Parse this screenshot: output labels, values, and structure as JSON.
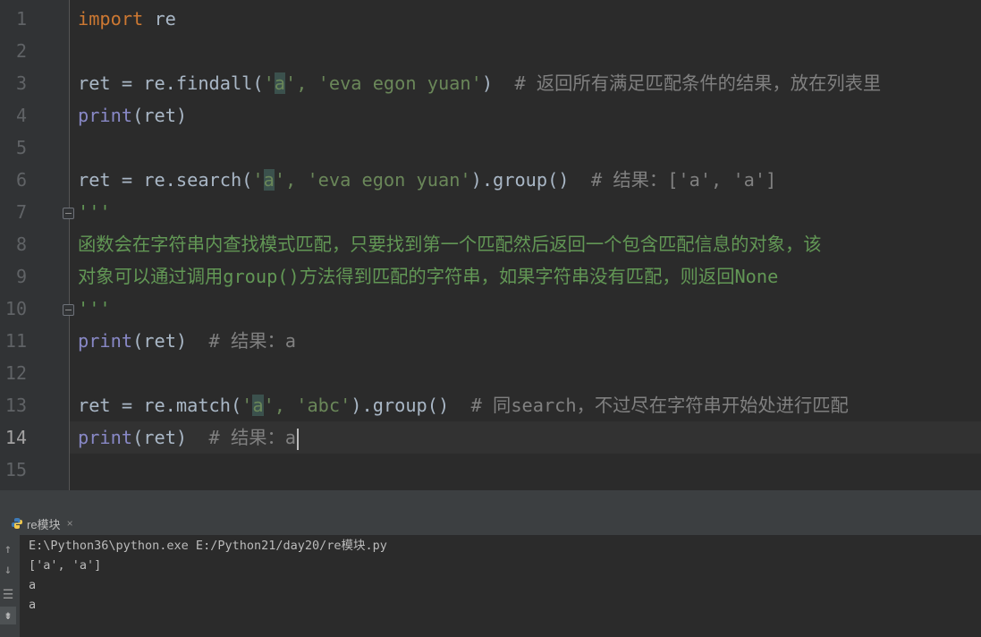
{
  "editor": {
    "line_numbers": [
      "1",
      "2",
      "3",
      "4",
      "5",
      "6",
      "7",
      "8",
      "9",
      "10",
      "11",
      "12",
      "13",
      "14",
      "15"
    ],
    "current_line": "14",
    "lines": {
      "l1": {
        "kw": "import",
        "rest": " re"
      },
      "l3": {
        "code_a": "ret = re.findall(",
        "q1": "'",
        "m": "a",
        "q2": "', ",
        "s2": "'eva egon yuan'",
        "code_b": ")  ",
        "comment": "# 返回所有满足匹配条件的结果，放在列表里"
      },
      "l4": {
        "fn": "print",
        "rest": "(ret)"
      },
      "l6": {
        "code_a": "ret = re.search(",
        "q1": "'",
        "m": "a",
        "q2": "', ",
        "s2": "'eva egon yuan'",
        "code_b": ").group()  ",
        "comment": "# 结果：['a', 'a']"
      },
      "l7": {
        "doc": "'''"
      },
      "l8": {
        "doc": "函数会在字符串内查找模式匹配，只要找到第一个匹配然后返回一个包含匹配信息的对象，该"
      },
      "l9": {
        "doc": "对象可以通过调用group()方法得到匹配的字符串，如果字符串没有匹配，则返回None"
      },
      "l10": {
        "doc": "'''"
      },
      "l11": {
        "fn": "print",
        "rest": "(ret)  ",
        "comment": "# 结果：a"
      },
      "l13": {
        "code_a": "ret = re.match(",
        "q1": "'",
        "m": "a",
        "q2": "', ",
        "s2": "'abc'",
        "code_b": ").group()  ",
        "comment": "# 同search，不过尽在字符串开始处进行匹配"
      },
      "l14": {
        "fn": "print",
        "rest": "(ret)  ",
        "comment": "# 结果：a"
      }
    }
  },
  "run_panel": {
    "tab_label": "re模块",
    "tab_close": "×",
    "output": [
      "E:\\Python36\\python.exe E:/Python21/day20/re模块.py",
      "['a', 'a']",
      "a",
      "a"
    ]
  },
  "colors": {
    "editor_bg": "#2b2b2b",
    "keyword": "#cc7832",
    "builtin": "#8888c6",
    "string": "#6a8759",
    "comment": "#808080",
    "docstring": "#629755"
  },
  "icons": [
    "python-file-icon",
    "close-icon",
    "arrow-up-icon",
    "arrow-down-icon",
    "soft-wrap-icon",
    "scroll-to-end-icon",
    "fold-marker-icon"
  ]
}
